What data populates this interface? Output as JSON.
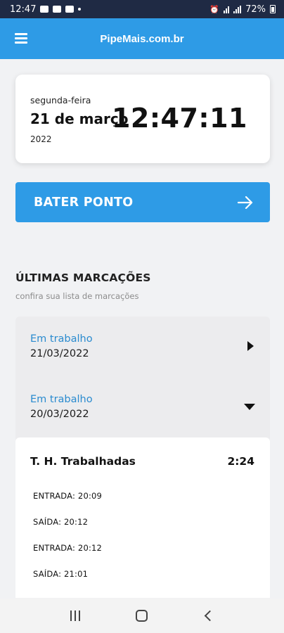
{
  "status_bar": {
    "time": "12:47",
    "battery": "72%"
  },
  "app_bar": {
    "title": "PipeMais.com.br"
  },
  "date_card": {
    "weekday": "segunda-feira",
    "day_month": "21 de março",
    "year": "2022",
    "clock": "12:47:11"
  },
  "punch_button": {
    "label": "BATER PONTO"
  },
  "section": {
    "title": "ÚLTIMAS MARCAÇÕES",
    "subtitle": "confira sua lista de marcações"
  },
  "entries": [
    {
      "status": "Em trabalho",
      "date": "21/03/2022",
      "expanded": false
    },
    {
      "status": "Em trabalho",
      "date": "20/03/2022",
      "expanded": true
    }
  ],
  "details": {
    "hours_label": "T. H. Trabalhadas",
    "hours_value": "2:24",
    "punches": [
      "ENTRADA: 20:09",
      "SAÍDA: 20:12",
      "ENTRADA: 20:12",
      "SAÍDA: 21:01"
    ]
  },
  "colors": {
    "primary": "#2e9be6",
    "status_bar": "#1f2a44",
    "entry_status": "#2a8bcf"
  }
}
